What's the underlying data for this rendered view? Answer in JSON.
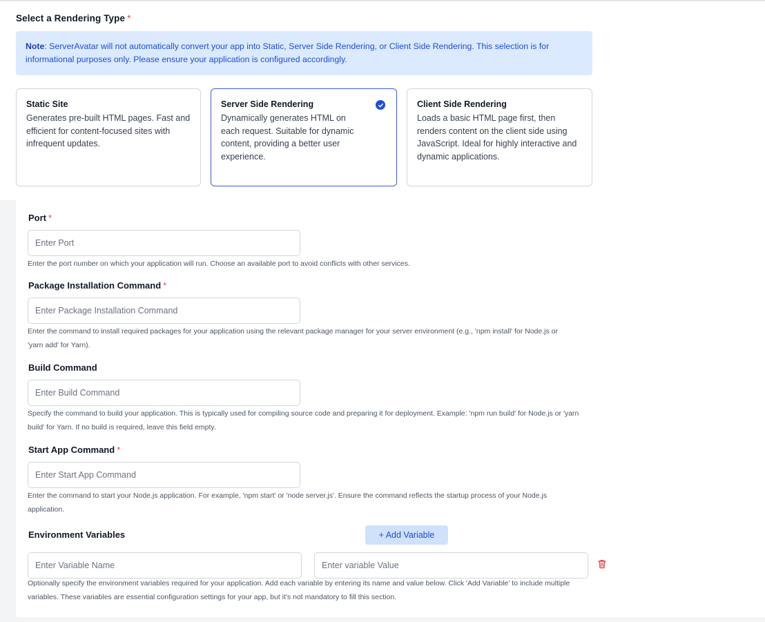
{
  "rendering": {
    "title": "Select a Rendering Type",
    "required_mark": "*",
    "note_label": "Note",
    "note_text": ": ServerAvatar will not automatically convert your app into Static, Server Side Rendering, or Client Side Rendering. This selection is for informational purposes only. Please ensure your application is configured accordingly.",
    "options": [
      {
        "title": "Static Site",
        "description": "Generates pre-built HTML pages. Fast and efficient for content-focused sites with infrequent updates.",
        "selected": false
      },
      {
        "title": "Server Side Rendering",
        "description": "Dynamically generates HTML on each request. Suitable for dynamic content, providing a better user experience.",
        "selected": true
      },
      {
        "title": "Client Side Rendering",
        "description": "Loads a basic HTML page first, then renders content on the client side using JavaScript. Ideal for highly interactive and dynamic applications.",
        "selected": false
      }
    ]
  },
  "form": {
    "port": {
      "label": "Port",
      "required": "*",
      "placeholder": "Enter Port",
      "help": "Enter the port number on which your application will run. Choose an available port to avoid conflicts with other services."
    },
    "package": {
      "label": "Package Installation Command",
      "required": "*",
      "placeholder": "Enter Package Installation Command",
      "help": "Enter the command to install required packages for your application using the relevant package manager for your server environment (e.g., 'npm install' for Node.js or 'yarn add' for Yarn)."
    },
    "build": {
      "label": "Build Command",
      "placeholder": "Enter Build Command",
      "help": "Specify the command to build your application. This is typically used for compiling source code and preparing it for deployment. Example: 'npm run build' for Node.js or 'yarn build' for Yarn. If no build is required, leave this field empty."
    },
    "start": {
      "label": "Start App Command",
      "required": "*",
      "placeholder": "Enter Start App Command",
      "help": "Enter the command to start your Node.js application. For example, 'npm start' or 'node server.js'. Ensure the command reflects the startup process of your Node.js application."
    },
    "env": {
      "label": "Environment Variables",
      "add_button": "+ Add Variable",
      "name_placeholder": "Enter Variable Name",
      "value_placeholder": "Enter variable Value",
      "help": "Optionally specify the environment variables required for your application. Add each variable by entering its name and value below. Click 'Add Variable' to include multiple variables. These variables are essential configuration settings for your app, but it's not mandatory to fill this section."
    }
  },
  "colors": {
    "accent": "#1d4ed8",
    "required": "#ef4444",
    "note_bg": "#dbeafe"
  }
}
